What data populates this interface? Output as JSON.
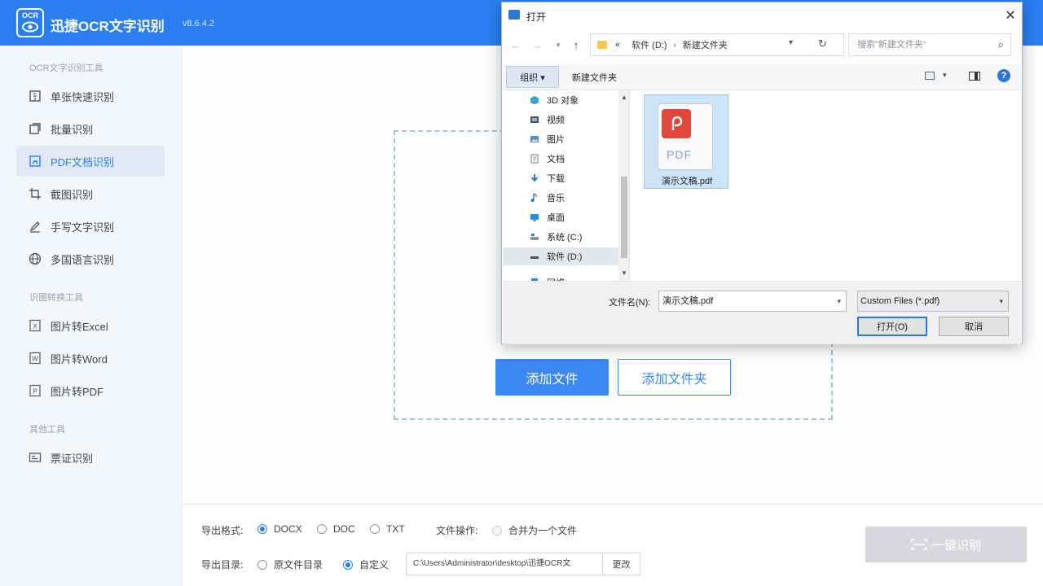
{
  "app": {
    "logo_text": "OCR",
    "name": "迅捷OCR文字识别",
    "version": "v8.6.4.2"
  },
  "sidebar": {
    "section1_title": "OCR文字识别工具",
    "items1": [
      {
        "label": "单张快速识别",
        "icon": "single-scan-icon"
      },
      {
        "label": "批量识别",
        "icon": "batch-icon"
      },
      {
        "label": "PDF文档识别",
        "icon": "pdf-icon"
      },
      {
        "label": "截图识别",
        "icon": "crop-icon"
      },
      {
        "label": "手写文字识别",
        "icon": "handwriting-icon"
      },
      {
        "label": "多国语言识别",
        "icon": "globe-icon"
      }
    ],
    "section2_title": "识图转换工具",
    "items2": [
      {
        "label": "图片转Excel",
        "icon": "excel-icon"
      },
      {
        "label": "图片转Word",
        "icon": "word-icon"
      },
      {
        "label": "图片转PDF",
        "icon": "pdf-file-icon"
      }
    ],
    "section3_title": "其他工具",
    "items3": [
      {
        "label": "票证识别",
        "icon": "id-card-icon"
      }
    ],
    "active_color": "#2b7ef0"
  },
  "main": {
    "add_file": "添加文件",
    "add_folder": "添加文件夹"
  },
  "bottom": {
    "format_label": "导出格式:",
    "formats": [
      "DOCX",
      "DOC",
      "TXT"
    ],
    "selected_format": "DOCX",
    "file_op_label": "文件操作:",
    "merge_label": "合并为一个文件",
    "dir_label": "导出目录:",
    "dir_options": [
      "原文件目录",
      "自定义"
    ],
    "selected_dir": "自定义",
    "path_value": "C:\\Users\\Administrator\\desktop\\迅捷OCR文",
    "change_label": "更改",
    "ocr_button": "一键识别"
  },
  "dialog": {
    "title": "打开",
    "close": "✕",
    "address": {
      "prefix": "«",
      "parts": [
        "软件 (D:)",
        "新建文件夹"
      ]
    },
    "search_placeholder": "搜索\"新建文件夹\"",
    "organize": "组织 ▾",
    "new_folder": "新建文件夹",
    "tree": [
      {
        "label": "3D 对象",
        "icon": "3d-objects-icon"
      },
      {
        "label": "视频",
        "icon": "video-icon"
      },
      {
        "label": "图片",
        "icon": "pictures-icon"
      },
      {
        "label": "文档",
        "icon": "documents-icon"
      },
      {
        "label": "下载",
        "icon": "download-icon"
      },
      {
        "label": "音乐",
        "icon": "music-icon"
      },
      {
        "label": "桌面",
        "icon": "desktop-icon"
      },
      {
        "label": "系统 (C:)",
        "icon": "drive-c-icon"
      },
      {
        "label": "软件 (D:)",
        "icon": "drive-d-icon"
      },
      {
        "label": "网络",
        "icon": "network-icon"
      }
    ],
    "selected_tree": "软件 (D:)",
    "file": {
      "name": "演示文稿.pdf",
      "type_text": "PDF"
    },
    "filename_label": "文件名(N):",
    "filename_value": "演示文稿.pdf",
    "filetype_value": "Custom Files (*.pdf)",
    "open_button": "打开(O)",
    "cancel_button": "取消"
  },
  "colors": {
    "brand": "#2b7ef0",
    "pdf_red": "#e2463a",
    "disabled_button": "#d6d8db"
  }
}
